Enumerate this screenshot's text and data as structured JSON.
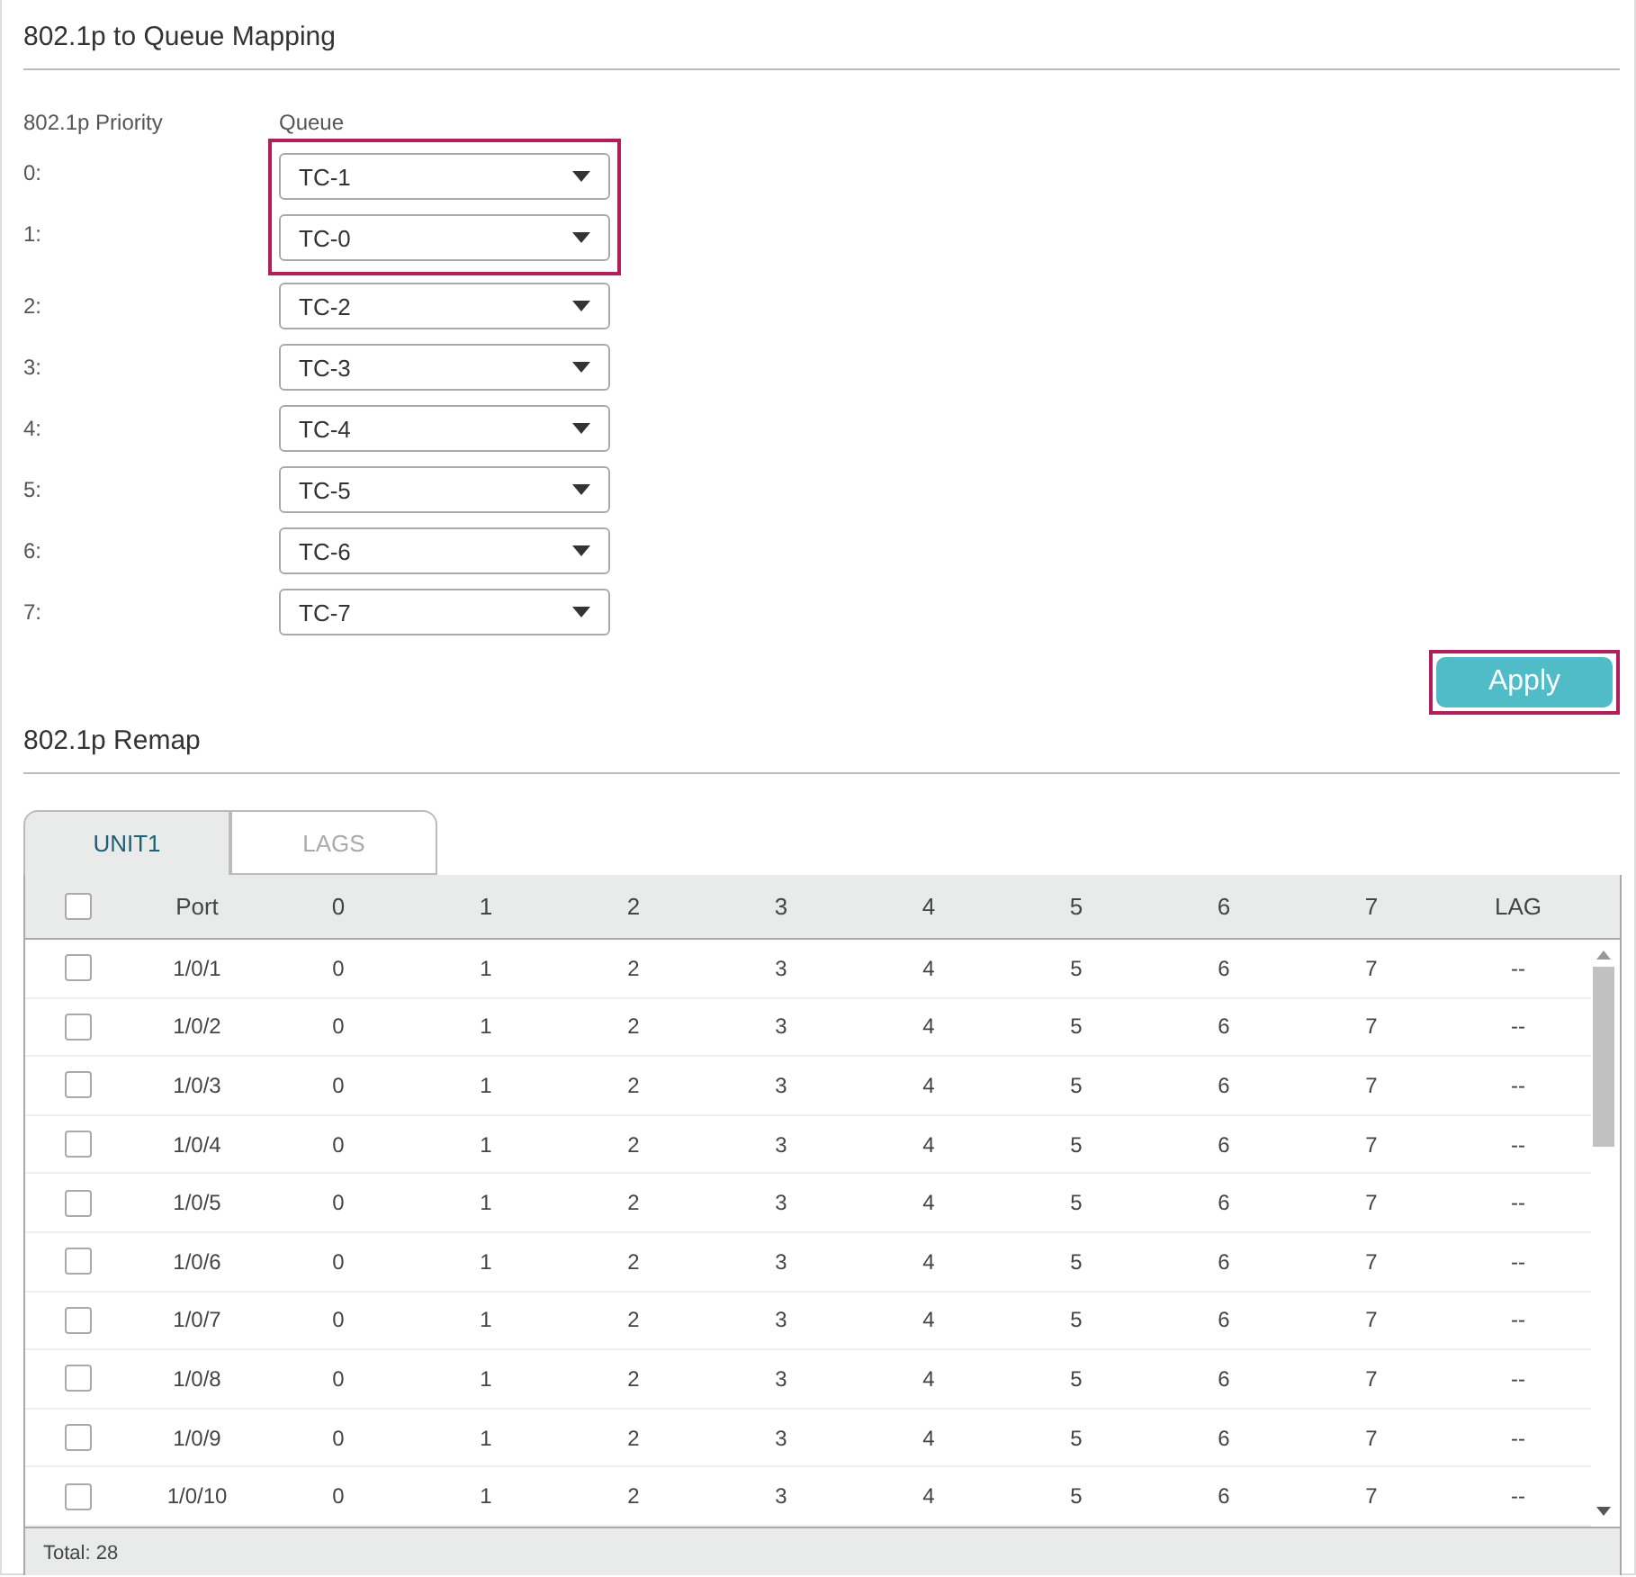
{
  "mapping": {
    "title": "802.1p to Queue Mapping",
    "priority_header": "802.1p Priority",
    "queue_header": "Queue",
    "rows": [
      {
        "priority": "0:",
        "queue": "TC-1",
        "highlighted": true
      },
      {
        "priority": "1:",
        "queue": "TC-0",
        "highlighted": true
      },
      {
        "priority": "2:",
        "queue": "TC-2",
        "highlighted": false
      },
      {
        "priority": "3:",
        "queue": "TC-3",
        "highlighted": false
      },
      {
        "priority": "4:",
        "queue": "TC-4",
        "highlighted": false
      },
      {
        "priority": "5:",
        "queue": "TC-5",
        "highlighted": false
      },
      {
        "priority": "6:",
        "queue": "TC-6",
        "highlighted": false
      },
      {
        "priority": "7:",
        "queue": "TC-7",
        "highlighted": false
      }
    ],
    "apply": {
      "label": "Apply",
      "highlighted": true
    }
  },
  "remap": {
    "title": "802.1p Remap",
    "tabs": [
      {
        "label": "UNIT1",
        "selected": true
      },
      {
        "label": "LAGS",
        "selected": false
      }
    ],
    "table": {
      "select_all_checked": false,
      "columns": [
        "Port",
        "0",
        "1",
        "2",
        "3",
        "4",
        "5",
        "6",
        "7",
        "LAG"
      ],
      "rows": [
        {
          "checked": false,
          "cells": [
            "1/0/1",
            "0",
            "1",
            "2",
            "3",
            "4",
            "5",
            "6",
            "7",
            "--"
          ]
        },
        {
          "checked": false,
          "cells": [
            "1/0/2",
            "0",
            "1",
            "2",
            "3",
            "4",
            "5",
            "6",
            "7",
            "--"
          ]
        },
        {
          "checked": false,
          "cells": [
            "1/0/3",
            "0",
            "1",
            "2",
            "3",
            "4",
            "5",
            "6",
            "7",
            "--"
          ]
        },
        {
          "checked": false,
          "cells": [
            "1/0/4",
            "0",
            "1",
            "2",
            "3",
            "4",
            "5",
            "6",
            "7",
            "--"
          ]
        },
        {
          "checked": false,
          "cells": [
            "1/0/5",
            "0",
            "1",
            "2",
            "3",
            "4",
            "5",
            "6",
            "7",
            "--"
          ]
        },
        {
          "checked": false,
          "cells": [
            "1/0/6",
            "0",
            "1",
            "2",
            "3",
            "4",
            "5",
            "6",
            "7",
            "--"
          ]
        },
        {
          "checked": false,
          "cells": [
            "1/0/7",
            "0",
            "1",
            "2",
            "3",
            "4",
            "5",
            "6",
            "7",
            "--"
          ]
        },
        {
          "checked": false,
          "cells": [
            "1/0/8",
            "0",
            "1",
            "2",
            "3",
            "4",
            "5",
            "6",
            "7",
            "--"
          ]
        },
        {
          "checked": false,
          "cells": [
            "1/0/9",
            "0",
            "1",
            "2",
            "3",
            "4",
            "5",
            "6",
            "7",
            "--"
          ]
        },
        {
          "checked": false,
          "cells": [
            "1/0/10",
            "0",
            "1",
            "2",
            "3",
            "4",
            "5",
            "6",
            "7",
            "--"
          ]
        }
      ],
      "total": "Total: 28"
    }
  }
}
